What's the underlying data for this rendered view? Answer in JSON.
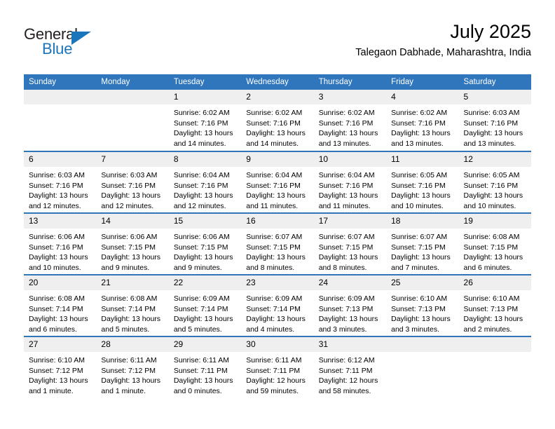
{
  "brand": {
    "word_one": "General",
    "word_two": "Blue",
    "logo_icon": "triangle-logo-icon",
    "accent_color": "#1b75bb"
  },
  "header": {
    "title": "July 2025",
    "subtitle": "Talegaon Dabhade, Maharashtra, India"
  },
  "theme": {
    "header_blue": "#2f76bc",
    "daynum_band": "#efefef",
    "text": "#000000"
  },
  "calendar": {
    "weekday_headers": [
      "Sunday",
      "Monday",
      "Tuesday",
      "Wednesday",
      "Thursday",
      "Friday",
      "Saturday"
    ],
    "weeks": [
      [
        {
          "day": "",
          "sunrise": "",
          "sunset": "",
          "daylight_line1": "",
          "daylight_line2": ""
        },
        {
          "day": "",
          "sunrise": "",
          "sunset": "",
          "daylight_line1": "",
          "daylight_line2": ""
        },
        {
          "day": "1",
          "sunrise": "Sunrise: 6:02 AM",
          "sunset": "Sunset: 7:16 PM",
          "daylight_line1": "Daylight: 13 hours",
          "daylight_line2": "and 14 minutes."
        },
        {
          "day": "2",
          "sunrise": "Sunrise: 6:02 AM",
          "sunset": "Sunset: 7:16 PM",
          "daylight_line1": "Daylight: 13 hours",
          "daylight_line2": "and 14 minutes."
        },
        {
          "day": "3",
          "sunrise": "Sunrise: 6:02 AM",
          "sunset": "Sunset: 7:16 PM",
          "daylight_line1": "Daylight: 13 hours",
          "daylight_line2": "and 13 minutes."
        },
        {
          "day": "4",
          "sunrise": "Sunrise: 6:02 AM",
          "sunset": "Sunset: 7:16 PM",
          "daylight_line1": "Daylight: 13 hours",
          "daylight_line2": "and 13 minutes."
        },
        {
          "day": "5",
          "sunrise": "Sunrise: 6:03 AM",
          "sunset": "Sunset: 7:16 PM",
          "daylight_line1": "Daylight: 13 hours",
          "daylight_line2": "and 13 minutes."
        }
      ],
      [
        {
          "day": "6",
          "sunrise": "Sunrise: 6:03 AM",
          "sunset": "Sunset: 7:16 PM",
          "daylight_line1": "Daylight: 13 hours",
          "daylight_line2": "and 12 minutes."
        },
        {
          "day": "7",
          "sunrise": "Sunrise: 6:03 AM",
          "sunset": "Sunset: 7:16 PM",
          "daylight_line1": "Daylight: 13 hours",
          "daylight_line2": "and 12 minutes."
        },
        {
          "day": "8",
          "sunrise": "Sunrise: 6:04 AM",
          "sunset": "Sunset: 7:16 PM",
          "daylight_line1": "Daylight: 13 hours",
          "daylight_line2": "and 12 minutes."
        },
        {
          "day": "9",
          "sunrise": "Sunrise: 6:04 AM",
          "sunset": "Sunset: 7:16 PM",
          "daylight_line1": "Daylight: 13 hours",
          "daylight_line2": "and 11 minutes."
        },
        {
          "day": "10",
          "sunrise": "Sunrise: 6:04 AM",
          "sunset": "Sunset: 7:16 PM",
          "daylight_line1": "Daylight: 13 hours",
          "daylight_line2": "and 11 minutes."
        },
        {
          "day": "11",
          "sunrise": "Sunrise: 6:05 AM",
          "sunset": "Sunset: 7:16 PM",
          "daylight_line1": "Daylight: 13 hours",
          "daylight_line2": "and 10 minutes."
        },
        {
          "day": "12",
          "sunrise": "Sunrise: 6:05 AM",
          "sunset": "Sunset: 7:16 PM",
          "daylight_line1": "Daylight: 13 hours",
          "daylight_line2": "and 10 minutes."
        }
      ],
      [
        {
          "day": "13",
          "sunrise": "Sunrise: 6:06 AM",
          "sunset": "Sunset: 7:16 PM",
          "daylight_line1": "Daylight: 13 hours",
          "daylight_line2": "and 10 minutes."
        },
        {
          "day": "14",
          "sunrise": "Sunrise: 6:06 AM",
          "sunset": "Sunset: 7:15 PM",
          "daylight_line1": "Daylight: 13 hours",
          "daylight_line2": "and 9 minutes."
        },
        {
          "day": "15",
          "sunrise": "Sunrise: 6:06 AM",
          "sunset": "Sunset: 7:15 PM",
          "daylight_line1": "Daylight: 13 hours",
          "daylight_line2": "and 9 minutes."
        },
        {
          "day": "16",
          "sunrise": "Sunrise: 6:07 AM",
          "sunset": "Sunset: 7:15 PM",
          "daylight_line1": "Daylight: 13 hours",
          "daylight_line2": "and 8 minutes."
        },
        {
          "day": "17",
          "sunrise": "Sunrise: 6:07 AM",
          "sunset": "Sunset: 7:15 PM",
          "daylight_line1": "Daylight: 13 hours",
          "daylight_line2": "and 8 minutes."
        },
        {
          "day": "18",
          "sunrise": "Sunrise: 6:07 AM",
          "sunset": "Sunset: 7:15 PM",
          "daylight_line1": "Daylight: 13 hours",
          "daylight_line2": "and 7 minutes."
        },
        {
          "day": "19",
          "sunrise": "Sunrise: 6:08 AM",
          "sunset": "Sunset: 7:15 PM",
          "daylight_line1": "Daylight: 13 hours",
          "daylight_line2": "and 6 minutes."
        }
      ],
      [
        {
          "day": "20",
          "sunrise": "Sunrise: 6:08 AM",
          "sunset": "Sunset: 7:14 PM",
          "daylight_line1": "Daylight: 13 hours",
          "daylight_line2": "and 6 minutes."
        },
        {
          "day": "21",
          "sunrise": "Sunrise: 6:08 AM",
          "sunset": "Sunset: 7:14 PM",
          "daylight_line1": "Daylight: 13 hours",
          "daylight_line2": "and 5 minutes."
        },
        {
          "day": "22",
          "sunrise": "Sunrise: 6:09 AM",
          "sunset": "Sunset: 7:14 PM",
          "daylight_line1": "Daylight: 13 hours",
          "daylight_line2": "and 5 minutes."
        },
        {
          "day": "23",
          "sunrise": "Sunrise: 6:09 AM",
          "sunset": "Sunset: 7:14 PM",
          "daylight_line1": "Daylight: 13 hours",
          "daylight_line2": "and 4 minutes."
        },
        {
          "day": "24",
          "sunrise": "Sunrise: 6:09 AM",
          "sunset": "Sunset: 7:13 PM",
          "daylight_line1": "Daylight: 13 hours",
          "daylight_line2": "and 3 minutes."
        },
        {
          "day": "25",
          "sunrise": "Sunrise: 6:10 AM",
          "sunset": "Sunset: 7:13 PM",
          "daylight_line1": "Daylight: 13 hours",
          "daylight_line2": "and 3 minutes."
        },
        {
          "day": "26",
          "sunrise": "Sunrise: 6:10 AM",
          "sunset": "Sunset: 7:13 PM",
          "daylight_line1": "Daylight: 13 hours",
          "daylight_line2": "and 2 minutes."
        }
      ],
      [
        {
          "day": "27",
          "sunrise": "Sunrise: 6:10 AM",
          "sunset": "Sunset: 7:12 PM",
          "daylight_line1": "Daylight: 13 hours",
          "daylight_line2": "and 1 minute."
        },
        {
          "day": "28",
          "sunrise": "Sunrise: 6:11 AM",
          "sunset": "Sunset: 7:12 PM",
          "daylight_line1": "Daylight: 13 hours",
          "daylight_line2": "and 1 minute."
        },
        {
          "day": "29",
          "sunrise": "Sunrise: 6:11 AM",
          "sunset": "Sunset: 7:11 PM",
          "daylight_line1": "Daylight: 13 hours",
          "daylight_line2": "and 0 minutes."
        },
        {
          "day": "30",
          "sunrise": "Sunrise: 6:11 AM",
          "sunset": "Sunset: 7:11 PM",
          "daylight_line1": "Daylight: 12 hours",
          "daylight_line2": "and 59 minutes."
        },
        {
          "day": "31",
          "sunrise": "Sunrise: 6:12 AM",
          "sunset": "Sunset: 7:11 PM",
          "daylight_line1": "Daylight: 12 hours",
          "daylight_line2": "and 58 minutes."
        },
        {
          "day": "",
          "sunrise": "",
          "sunset": "",
          "daylight_line1": "",
          "daylight_line2": ""
        },
        {
          "day": "",
          "sunrise": "",
          "sunset": "",
          "daylight_line1": "",
          "daylight_line2": ""
        }
      ]
    ]
  }
}
